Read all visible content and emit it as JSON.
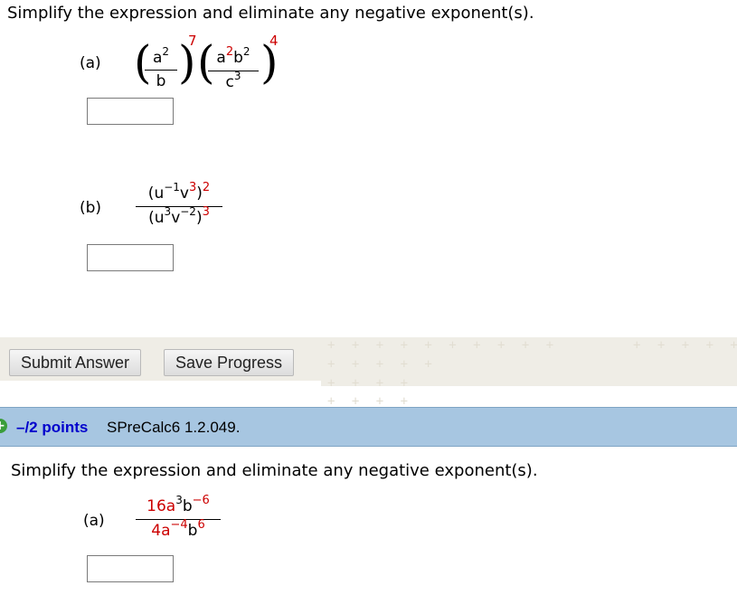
{
  "q1": {
    "instruction": "Simplify the expression and eliminate any negative exponent(s).",
    "parts": {
      "a": {
        "label": "(a)",
        "f1": {
          "num_base": "a",
          "num_exp": "2",
          "den": "b"
        },
        "f1_outer_exp": "7",
        "f2": {
          "num_a": "a",
          "num_a_exp": "2",
          "num_b": "b",
          "num_b_exp": "2",
          "den_base": "c",
          "den_exp": "3"
        },
        "f2_outer_exp": "4",
        "answer": ""
      },
      "b": {
        "label": "(b)",
        "num": {
          "open": "(",
          "u": "u",
          "u_exp": "−1",
          "v": "v",
          "v_exp": "3",
          "close": ")",
          "outer_exp": "2"
        },
        "den": {
          "open": "(",
          "u": "u",
          "u_exp": "3",
          "v": "v",
          "v_exp": "−2",
          "close": ")",
          "outer_exp": "3"
        },
        "answer": ""
      }
    }
  },
  "buttons": {
    "submit": "Submit Answer",
    "save": "Save Progress"
  },
  "q2": {
    "points": "–/2 points",
    "code": "SPreCalc6 1.2.049.",
    "instruction": "Simplify the expression and eliminate any negative exponent(s).",
    "parts": {
      "a": {
        "label": "(a)",
        "num": {
          "coef": "16",
          "a": "a",
          "a_exp": "3",
          "b": "b",
          "b_exp": "−6"
        },
        "den": {
          "coef": "4",
          "a": "a",
          "a_exp": "−4",
          "b": "b",
          "b_exp": "6"
        },
        "answer": ""
      }
    }
  },
  "colors": {
    "exponent_red": "#cc0000",
    "question_bar": "#a7c6e1",
    "button_panel": "#efede6"
  }
}
